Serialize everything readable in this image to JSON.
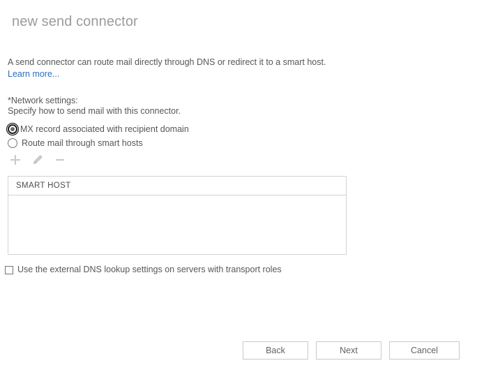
{
  "window": {
    "title": "new send connector"
  },
  "intro": {
    "text": "A send connector can route mail directly through DNS or redirect it to a smart host. ",
    "link_label": "Learn more..."
  },
  "network_settings": {
    "required_label": "*Network settings:",
    "hint": "Specify how to send mail with this connector.",
    "options": [
      {
        "label": "MX record associated with recipient domain",
        "selected": true
      },
      {
        "label": "Route mail through smart hosts",
        "selected": false
      }
    ]
  },
  "toolbar": {
    "add_icon": "plus-icon",
    "edit_icon": "pencil-icon",
    "remove_icon": "minus-icon",
    "add_label": "Add",
    "edit_label": "Edit",
    "remove_label": "Remove",
    "enabled": false
  },
  "smart_host_table": {
    "columns": [
      "SMART HOST"
    ],
    "rows": []
  },
  "external_dns": {
    "label": "Use the external DNS lookup settings on servers with transport roles",
    "checked": false
  },
  "footer": {
    "back_label": "Back",
    "next_label": "Next",
    "cancel_label": "Cancel"
  },
  "colors": {
    "background": "#ffffff",
    "title": "#9b9b9b",
    "text": "#575757",
    "link": "#2a6ebb",
    "border": "#cfd4d8",
    "button_border": "#c9c9c9",
    "icon_disabled": "#c8c8c8"
  }
}
